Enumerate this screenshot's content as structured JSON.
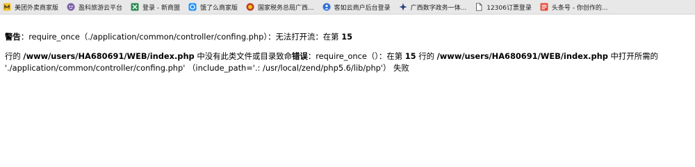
{
  "bookmarks": [
    {
      "label": "美团外卖商家版",
      "icon": "meituan-icon",
      "color": "#f6c12d"
    },
    {
      "label": "盈科旅游云平台",
      "icon": "yingke-icon",
      "color": "#7b5ea7"
    },
    {
      "label": "登录 - 新商盟",
      "icon": "xinshangmeng-icon",
      "color": "#2e8b57"
    },
    {
      "label": "饿了么商家版",
      "icon": "eleme-icon",
      "color": "#1e90ff"
    },
    {
      "label": "国家税务总局广西...",
      "icon": "tax-bureau-icon",
      "color": "#c0392b"
    },
    {
      "label": "客如云商户后台登录",
      "icon": "keruyun-icon",
      "color": "#2f6fd6"
    },
    {
      "label": "广西数字政务一体...",
      "icon": "gxgov-icon",
      "color": "#2a3f7a"
    },
    {
      "label": "12306订票登录",
      "icon": "document-icon",
      "color": "#555555"
    },
    {
      "label": "头条号 - 你创作的...",
      "icon": "toutiao-icon",
      "color": "#e74c3c"
    }
  ],
  "warning": {
    "prefix": "警告",
    "sep1": "：require_once（./application/common/controller/confing.php）：无法打开流：在第 ",
    "line": "15"
  },
  "error": {
    "p1": "行的 ",
    "path1": "/www/users/HA680691/WEB/index.php",
    "p2": " 中没有此类文件或目录致命",
    "label": "错误",
    "p3": "：require_once（）：在第 ",
    "line": "15",
    "p4": " 行的 ",
    "path2": "/www/users/HA680691/WEB/index.php",
    "p5": " 中打开所需的 './application/common/controller/confing.php' （include_path='.: /usr/local/zend/php5.6/lib/php'） 失败"
  }
}
